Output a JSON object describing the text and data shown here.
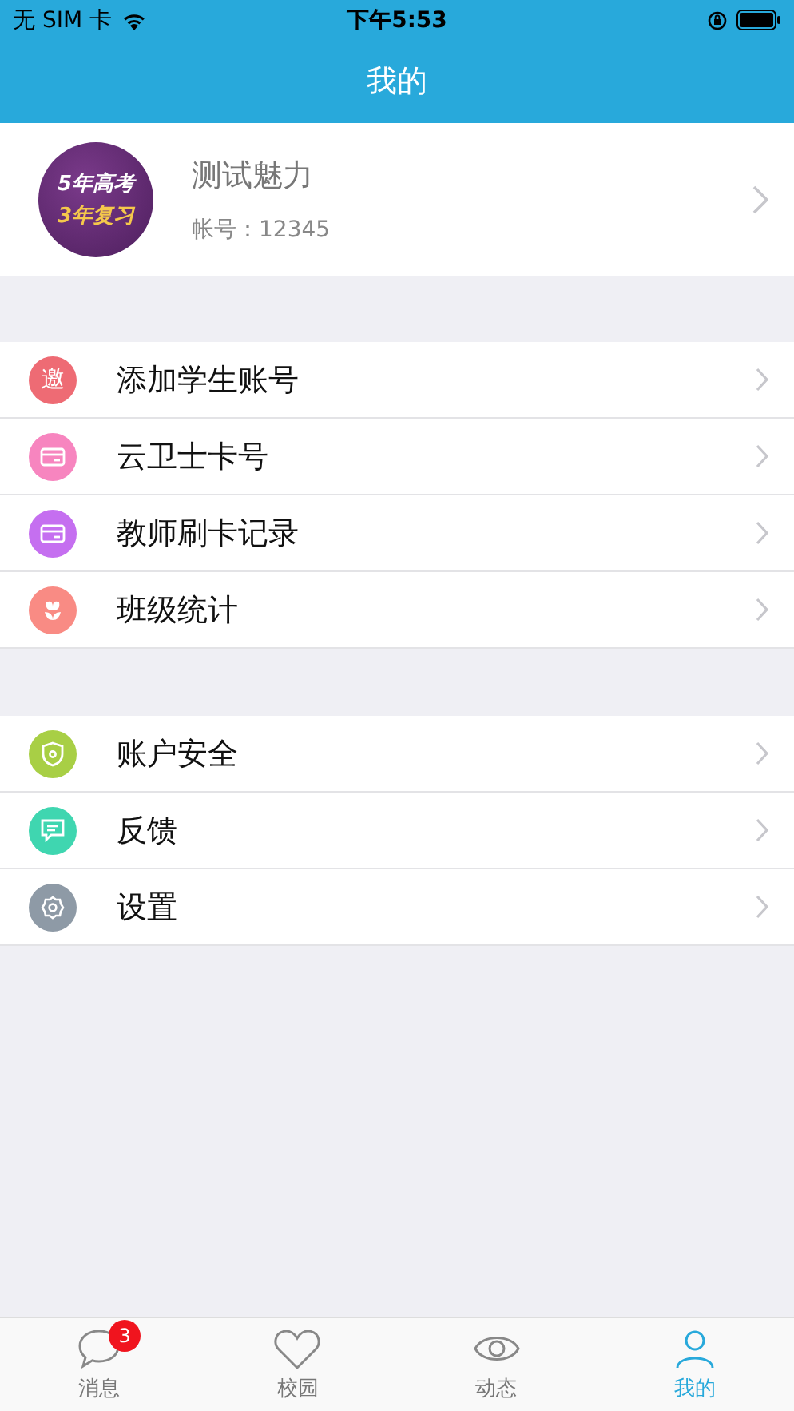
{
  "status_bar": {
    "carrier": "无 SIM 卡",
    "time": "下午5:53"
  },
  "nav_bar": {
    "title": "我的"
  },
  "profile": {
    "avatar_lines": [
      "5年高考",
      "3年复习"
    ],
    "name": "测试魅力",
    "account": "帐号：12345"
  },
  "menu_groups": [
    {
      "items": [
        {
          "label": "添加学生账号",
          "kind": "text",
          "icon_text": "邀",
          "color": "#ee6b74"
        },
        {
          "label": "云卫士卡号",
          "kind": "card",
          "color": "#f785bf"
        },
        {
          "label": "教师刷卡记录",
          "kind": "card",
          "color": "#c56ff0"
        },
        {
          "label": "班级统计",
          "kind": "flower",
          "color": "#f98b84"
        }
      ]
    },
    {
      "items": [
        {
          "label": "账户安全",
          "kind": "shield",
          "color": "#a8cf45"
        },
        {
          "label": "反馈",
          "kind": "chat",
          "color": "#3fd6b0"
        },
        {
          "label": "设置",
          "kind": "gear",
          "color": "#8e9aa6"
        }
      ]
    }
  ],
  "tab_bar": [
    {
      "label": "消息",
      "kind": "chat",
      "badge": "3",
      "selected": false
    },
    {
      "label": "校园",
      "kind": "heart",
      "selected": false
    },
    {
      "label": "动态",
      "kind": "eye",
      "selected": false
    },
    {
      "label": "我的",
      "kind": "person",
      "selected": true
    }
  ]
}
